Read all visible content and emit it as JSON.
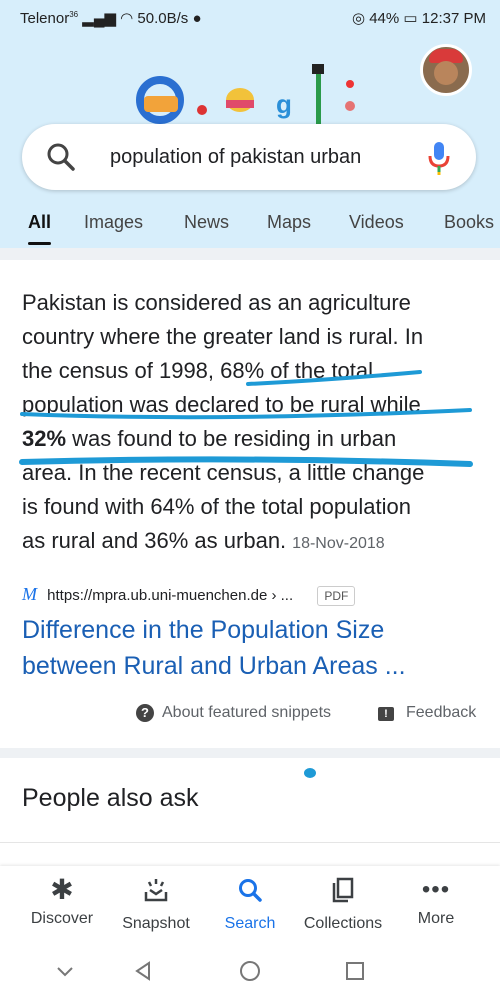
{
  "status_bar": {
    "carrier": "Telenor",
    "network": "36",
    "speed": "50.0B/s",
    "battery": "44%",
    "time": "12:37 PM"
  },
  "search": {
    "query": "population of pakistan urban"
  },
  "tabs": [
    "All",
    "Images",
    "News",
    "Maps",
    "Videos",
    "Books"
  ],
  "snippet": {
    "line1": "Pakistan is considered as an agriculture",
    "line2": "country where the greater land is rural. In",
    "line3": "the census of 1998, 68% of the total",
    "line4": "population was declared to be rural while",
    "bold": "32%",
    "line5": " was found to be residing in urban",
    "line6": "area. In the recent census, a little change",
    "line7": "is found with 64% of the total population",
    "line8": "as rural and 36% as urban.",
    "date": "18-Nov-2018"
  },
  "source": {
    "url": "https://mpra.ub.uni-muenchen.de › ...",
    "badge": "PDF",
    "icon": "M"
  },
  "result_title": {
    "line1": "Difference in the Population Size",
    "line2": "between Rural and Urban Areas ..."
  },
  "footer": {
    "about": "About featured snippets",
    "feedback": "Feedback"
  },
  "people_also_ask": "People also ask",
  "bottom_nav": [
    {
      "label": "Discover",
      "icon": "asterisk-icon"
    },
    {
      "label": "Snapshot",
      "icon": "snapshot-icon"
    },
    {
      "label": "Search",
      "icon": "search-icon"
    },
    {
      "label": "Collections",
      "icon": "collections-icon"
    },
    {
      "label": "More",
      "icon": "more-icon"
    }
  ],
  "colors": {
    "accent": "#1a73e8",
    "header_bg": "#d7eefb",
    "annotation": "#1e9ad6"
  }
}
